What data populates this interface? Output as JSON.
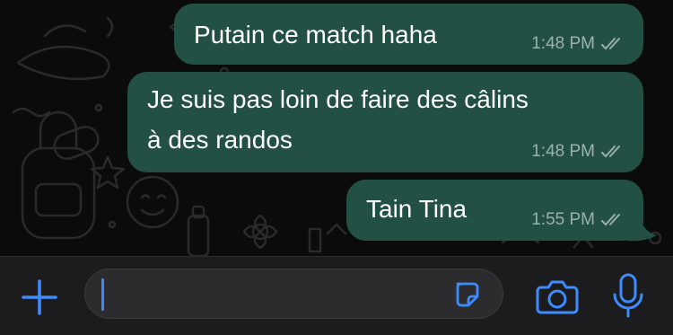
{
  "messages": [
    {
      "text": "Putain ce match haha",
      "time": "1:48 PM",
      "status": "read"
    },
    {
      "lines": [
        "Je suis pas loin de faire des câlins",
        "à des randos"
      ],
      "time": "1:48 PM",
      "status": "read"
    },
    {
      "text": "Tain Tina",
      "time": "1:55 PM",
      "status": "read"
    }
  ],
  "composer": {
    "input_value": "",
    "icons": [
      "plus-icon",
      "sticker-icon",
      "camera-icon",
      "microphone-icon"
    ]
  },
  "colors": {
    "background": "#0b0b0b",
    "bubble_outgoing": "#225044",
    "accent": "#3d8bfd",
    "composer_bg": "#1c1c1e"
  }
}
